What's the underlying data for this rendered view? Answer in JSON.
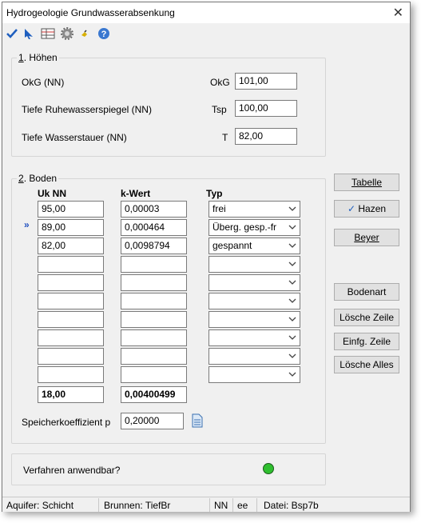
{
  "window": {
    "title": "Hydrogeologie Grundwasserabsenkung",
    "close": "✕"
  },
  "toolbar": {
    "icons": [
      "checkmark-icon",
      "pointer-icon",
      "table-icon",
      "gear-icon",
      "hand-icon",
      "help-icon"
    ]
  },
  "hoehen": {
    "legend_num": "1",
    "legend_text": ". Höhen",
    "rows": [
      {
        "label": "OkG (NN)",
        "symbol": "OkG",
        "value": "101,00"
      },
      {
        "label": "Tiefe Ruhewasserspiegel (NN)",
        "symbol": "Tsp",
        "value": "100,00"
      },
      {
        "label": "Tiefe Wasserstauer (NN)",
        "symbol": "T",
        "value": "82,00"
      }
    ]
  },
  "boden": {
    "legend_num": "2",
    "legend_text": ". Boden",
    "headers": {
      "uk": "Uk NN",
      "kwert": "k-Wert",
      "typ": "Typ"
    },
    "current_marker": "»",
    "rows": [
      {
        "uk": "95,00",
        "k": "0,00003",
        "typ": "frei"
      },
      {
        "uk": "89,00",
        "k": "0,000464",
        "typ": "Überg. gesp.-fr"
      },
      {
        "uk": "82,00",
        "k": "0,0098794",
        "typ": "gespannt"
      },
      {
        "uk": "",
        "k": "",
        "typ": ""
      },
      {
        "uk": "",
        "k": "",
        "typ": ""
      },
      {
        "uk": "",
        "k": "",
        "typ": ""
      },
      {
        "uk": "",
        "k": "",
        "typ": ""
      },
      {
        "uk": "",
        "k": "",
        "typ": ""
      },
      {
        "uk": "",
        "k": "",
        "typ": ""
      },
      {
        "uk": "",
        "k": "",
        "typ": ""
      }
    ],
    "totals": {
      "uk": "18,00",
      "k": "0,00400499"
    },
    "speicher_label": "Speicherkoeffizient p",
    "speicher_value": "0,20000"
  },
  "buttons": {
    "tabelle": "Tabelle",
    "hazen": "Hazen",
    "beyer": "Beyer",
    "bodenart": "Bodenart",
    "loesche_zeile": "Lösche Zeile",
    "einfg_zeile": "Einfg. Zeile",
    "loesche_alles": "Lösche Alles"
  },
  "verfahren": {
    "label": "Verfahren anwendbar?",
    "status_color": "#2fbf2f"
  },
  "statusbar": {
    "aquifer": "Aquifer: Schicht",
    "brunnen": "Brunnen: TiefBr",
    "nn": "NN",
    "ee": "ee",
    "datei": "Datei: Bsp7b"
  }
}
